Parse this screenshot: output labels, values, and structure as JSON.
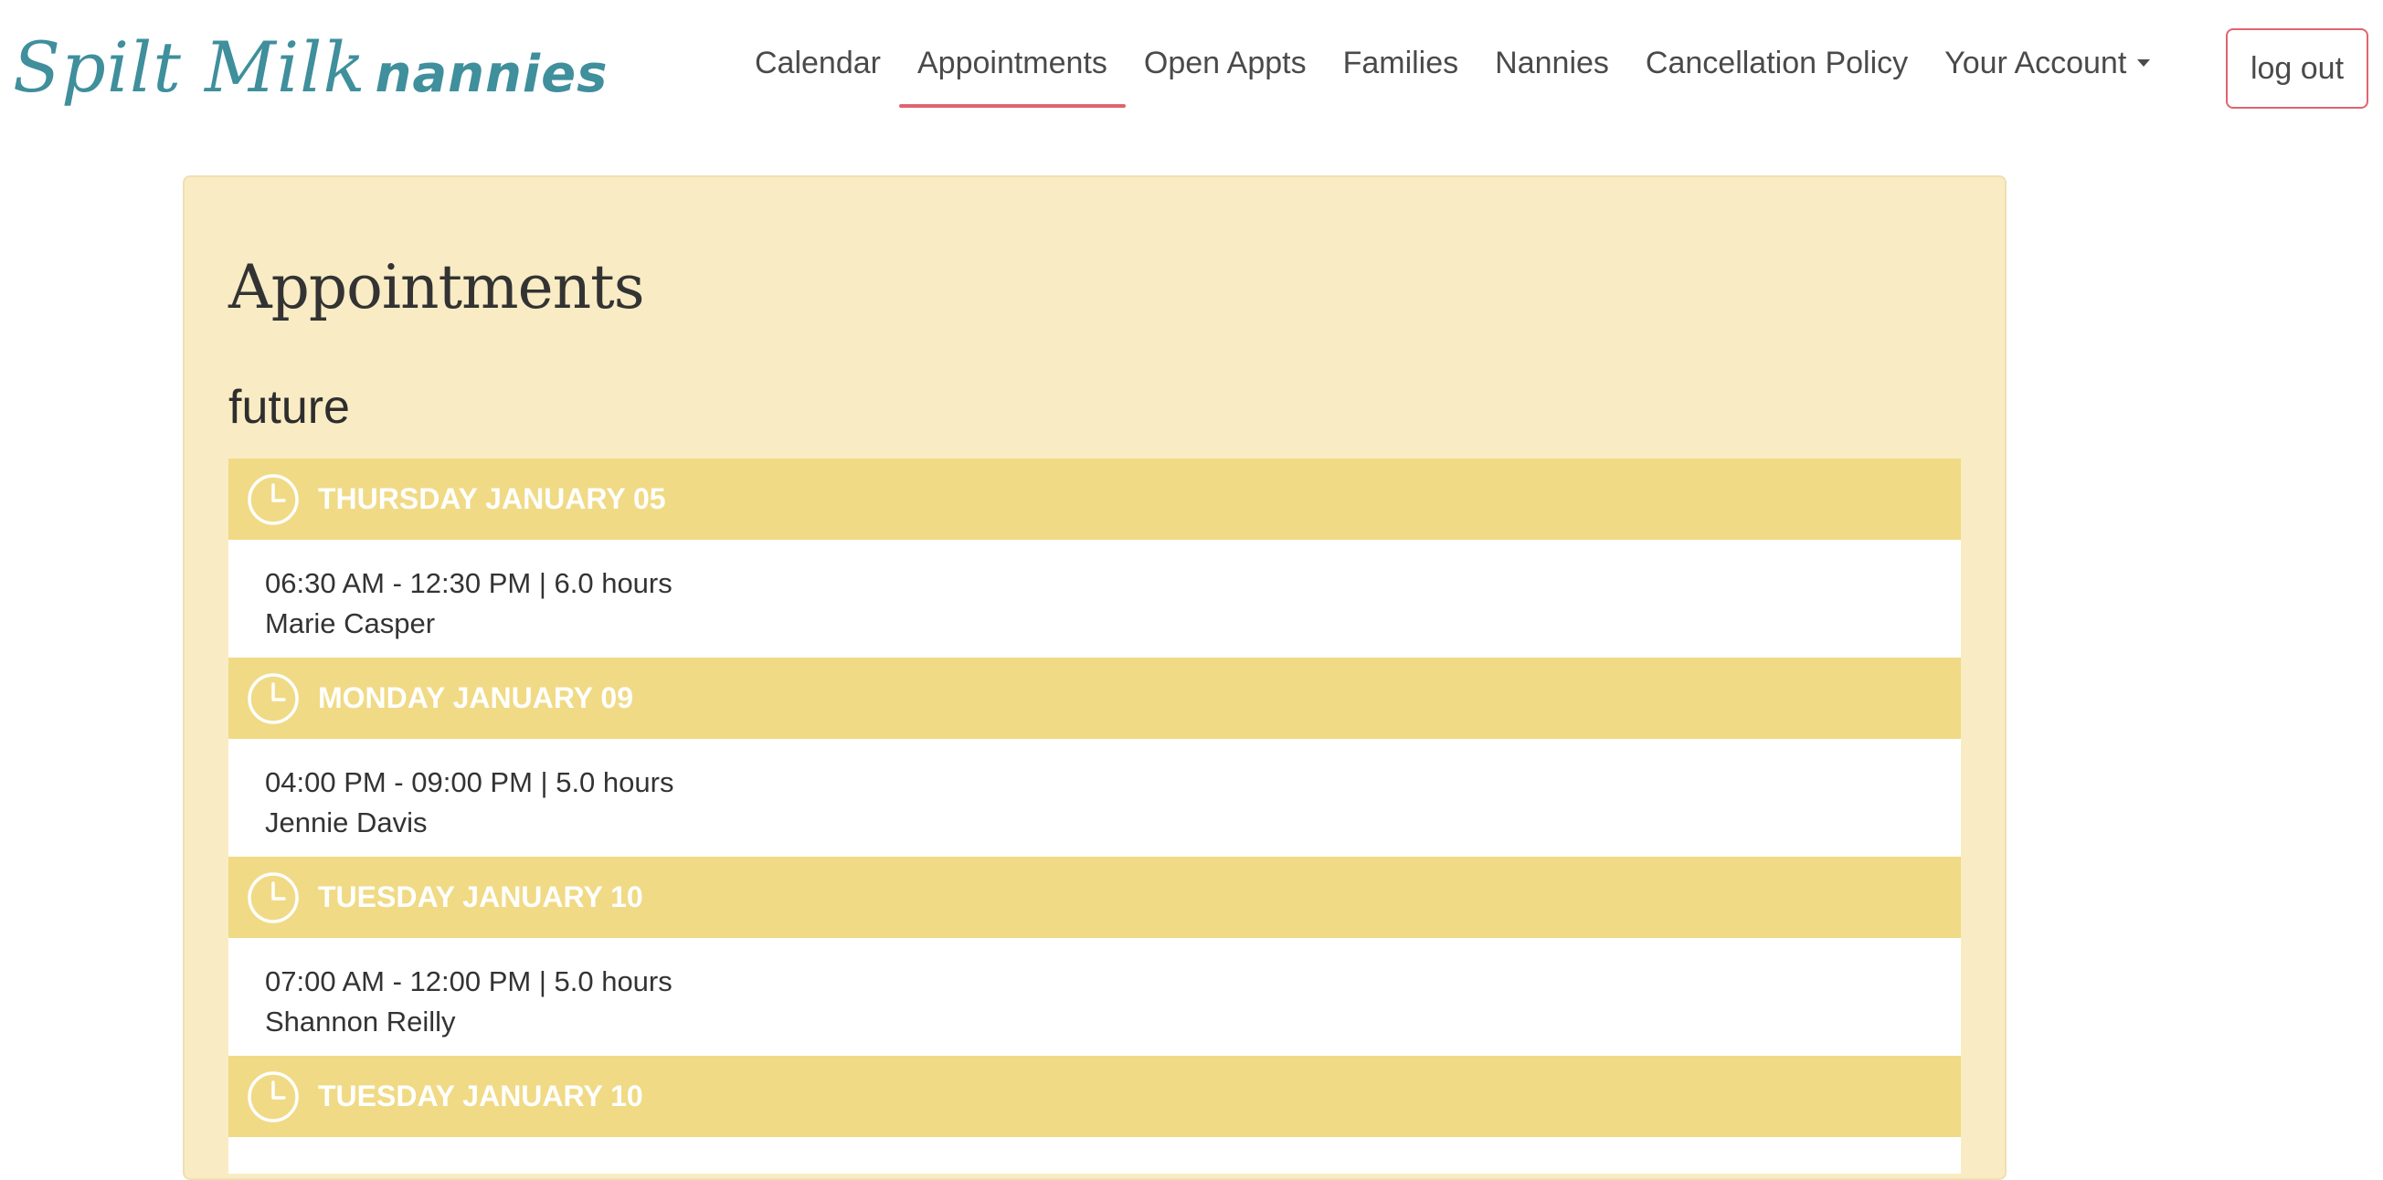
{
  "brand": {
    "part1": "Spilt Milk",
    "part2": "nannies",
    "color": "#3f8f9c"
  },
  "nav": {
    "items": [
      {
        "label": "Calendar",
        "active": false
      },
      {
        "label": "Appointments",
        "active": true
      },
      {
        "label": "Open Appts",
        "active": false
      },
      {
        "label": "Families",
        "active": false
      },
      {
        "label": "Nannies",
        "active": false
      },
      {
        "label": "Cancellation Policy",
        "active": false
      },
      {
        "label": "Your Account",
        "active": false,
        "dropdown": true
      }
    ],
    "logout_label": "log out",
    "accent_color": "#e0646f"
  },
  "page": {
    "title": "Appointments",
    "section": "future",
    "panel_color": "#f9ecc4",
    "header_color": "#f0da85"
  },
  "appointments": [
    {
      "day": "THURSDAY JANUARY 05",
      "icon": "clock-icon",
      "time": "06:30 AM - 12:30 PM | 6.0 hours",
      "nanny": "Marie Casper"
    },
    {
      "day": "MONDAY JANUARY 09",
      "icon": "clock-icon",
      "time": "04:00 PM - 09:00 PM | 5.0 hours",
      "nanny": "Jennie Davis"
    },
    {
      "day": "TUESDAY JANUARY 10",
      "icon": "clock-icon",
      "time": "07:00 AM - 12:00 PM | 5.0 hours",
      "nanny": "Shannon Reilly"
    },
    {
      "day": "TUESDAY JANUARY 10",
      "icon": "clock-icon"
    }
  ]
}
